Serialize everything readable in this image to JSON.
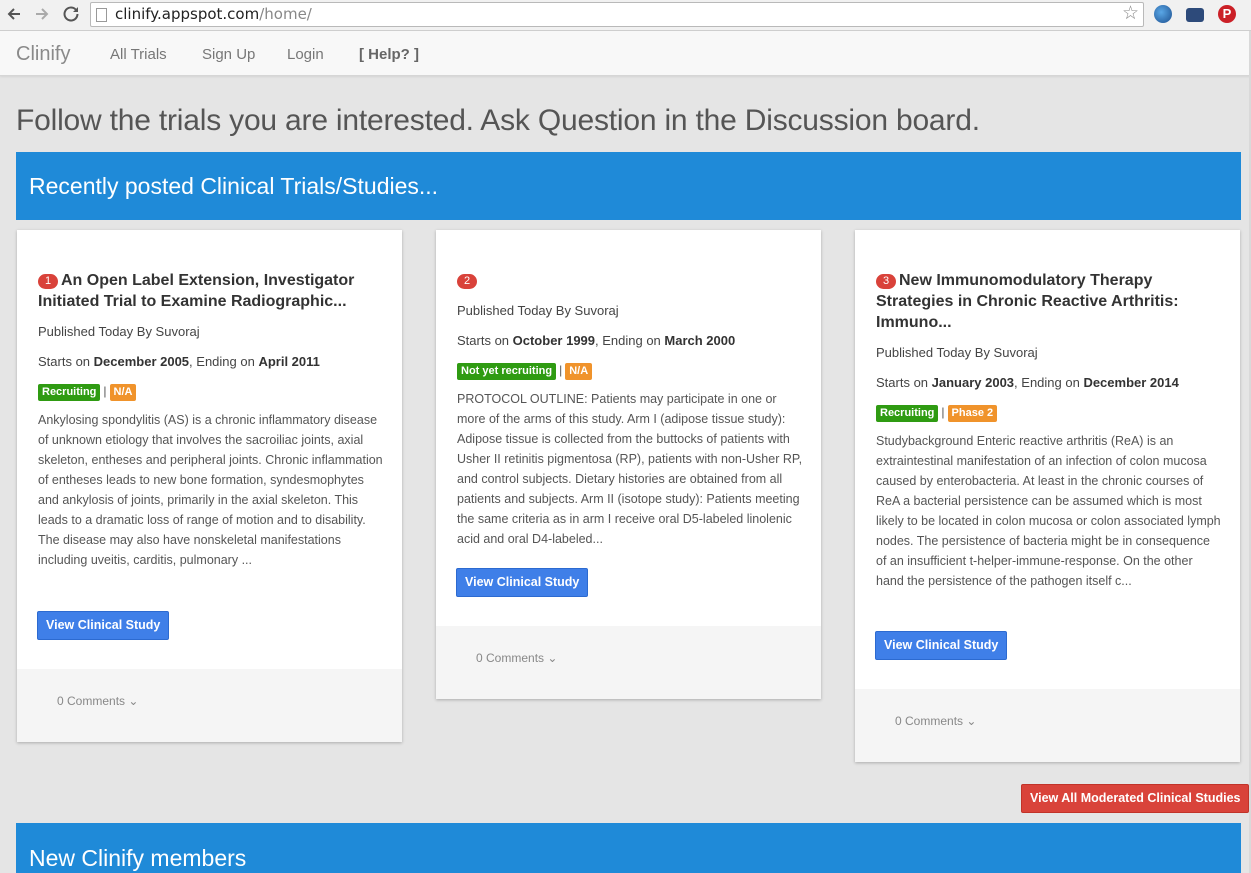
{
  "browser": {
    "url_host": "clinify.appspot.com",
    "url_path": "/home/"
  },
  "navbar": {
    "brand": "Clinify",
    "links": [
      "All Trials",
      "Sign Up",
      "Login",
      "[ Help? ]"
    ]
  },
  "headline": "Follow the trials you are interested. Ask Question in the Discussion board.",
  "recent_section": {
    "title": "Recently posted Clinical Trials/Studies..."
  },
  "cards": [
    {
      "number": "1",
      "title": "An Open Label Extension, Investigator Initiated Trial to Examine Radiographic...",
      "published": "Published Today By Suvoraj",
      "starts_prefix": "Starts on ",
      "start": "December 2005",
      "ending_prefix": ", Ending on ",
      "end": "April 2011",
      "status": "Recruiting",
      "phase": "N/A",
      "separator": "|",
      "description": "Ankylosing spondylitis (AS) is a chronic inflammatory disease of unknown etiology that involves the sacroiliac joints, axial skeleton, entheses and peripheral joints. Chronic inflammation of entheses leads to new bone formation, syndesmophytes and ankylosis of joints, primarily in the axial skeleton. This leads to a dramatic loss of range of motion and to disability. The disease may also have nonskeletal manifestations including uveitis, carditis, pulmonary ...",
      "button": "View Clinical Study",
      "comments": "0 Comments ⌄"
    },
    {
      "number": "2",
      "title": "",
      "published": "Published Today By Suvoraj",
      "starts_prefix": "Starts on ",
      "start": "October 1999",
      "ending_prefix": ", Ending on ",
      "end": "March 2000",
      "status": "Not yet recruiting",
      "phase": "N/A",
      "separator": "|",
      "description": "PROTOCOL OUTLINE: Patients may participate in one or more of the arms of this study. Arm I (adipose tissue study): Adipose tissue is collected from the buttocks of patients with Usher II retinitis pigmentosa (RP), patients with non-Usher RP, and control subjects. Dietary histories are obtained from all patients and subjects. Arm II (isotope study): Patients meeting the same criteria as in arm I receive oral D5-labeled linolenic acid and oral D4-labeled...",
      "button": "View Clinical Study",
      "comments": "0 Comments ⌄"
    },
    {
      "number": "3",
      "title": "New Immunomodulatory Therapy Strategies in Chronic Reactive Arthritis: Immuno...",
      "published": "Published Today By Suvoraj",
      "starts_prefix": "Starts on ",
      "start": "January 2003",
      "ending_prefix": ", Ending on ",
      "end": "December 2014",
      "status": "Recruiting",
      "phase": "Phase 2",
      "separator": "|",
      "description": "Studybackground Enteric reactive arthritis (ReA) is an extraintestinal manifestation of an infection of colon mucosa caused by enterobacteria. At least in the chronic courses of ReA a bacterial persistence can be assumed which is most likely to be located in colon mucosa or colon associated lymph nodes. The persistence of bacteria might be in consequence of an insufficient t-helper-immune-response. On the other hand the persistence of the pathogen itself c...",
      "button": "View Clinical Study",
      "comments": "0 Comments ⌄"
    }
  ],
  "view_all_button": "View All Moderated Clinical Studies",
  "members_section": {
    "title": "New Clinify members"
  },
  "colors": {
    "banner": "#1f8ad8",
    "primary_button": "#3f7fe8",
    "danger_button": "#d9433a",
    "recruiting_label": "#2f9b12",
    "phase_label": "#f0932b",
    "number_badge": "#d9423a"
  }
}
